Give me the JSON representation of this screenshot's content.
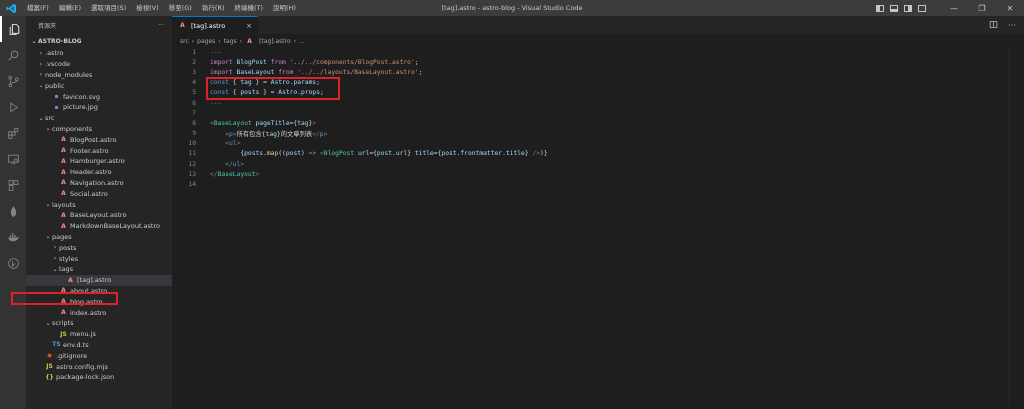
{
  "titlebar": {
    "menu": [
      "檔案(F)",
      "編輯(E)",
      "選取項目(S)",
      "檢視(V)",
      "移至(G)",
      "執行(R)",
      "終端機(T)",
      "說明(H)"
    ],
    "window_title": "[tag].astro - astro-blog - Visual Studio Code",
    "minimize": "—",
    "maximize": "❐",
    "close": "✕"
  },
  "sidebar": {
    "header": "資源夾",
    "more": "···",
    "project": "ASTRO-BLOG",
    "tree": [
      {
        "label": ".astro",
        "indent": 1,
        "chev": "›",
        "icon": ""
      },
      {
        "label": ".vscode",
        "indent": 1,
        "chev": "›",
        "icon": ""
      },
      {
        "label": "node_modules",
        "indent": 1,
        "chev": "›",
        "icon": ""
      },
      {
        "label": "public",
        "indent": 1,
        "chev": "⌄",
        "icon": ""
      },
      {
        "label": "favicon.svg",
        "indent": 2,
        "chev": "",
        "icon": "img"
      },
      {
        "label": "picture.jpg",
        "indent": 2,
        "chev": "",
        "icon": "img"
      },
      {
        "label": "src",
        "indent": 1,
        "chev": "⌄",
        "icon": ""
      },
      {
        "label": "components",
        "indent": 2,
        "chev": "⌄",
        "icon": ""
      },
      {
        "label": "BlogPost.astro",
        "indent": 3,
        "chev": "",
        "icon": "astro"
      },
      {
        "label": "Footer.astro",
        "indent": 3,
        "chev": "",
        "icon": "astro"
      },
      {
        "label": "Hamburger.astro",
        "indent": 3,
        "chev": "",
        "icon": "astro"
      },
      {
        "label": "Header.astro",
        "indent": 3,
        "chev": "",
        "icon": "astro"
      },
      {
        "label": "Navigation.astro",
        "indent": 3,
        "chev": "",
        "icon": "astro"
      },
      {
        "label": "Social.astro",
        "indent": 3,
        "chev": "",
        "icon": "astro"
      },
      {
        "label": "layouts",
        "indent": 2,
        "chev": "⌄",
        "icon": ""
      },
      {
        "label": "BaseLayout.astro",
        "indent": 3,
        "chev": "",
        "icon": "astro"
      },
      {
        "label": "MarkdownBaseLayout.astro",
        "indent": 3,
        "chev": "",
        "icon": "astro"
      },
      {
        "label": "pages",
        "indent": 2,
        "chev": "⌄",
        "icon": ""
      },
      {
        "label": "posts",
        "indent": 3,
        "chev": "›",
        "icon": ""
      },
      {
        "label": "styles",
        "indent": 3,
        "chev": "›",
        "icon": ""
      },
      {
        "label": "tags",
        "indent": 3,
        "chev": "⌄",
        "icon": ""
      },
      {
        "label": "[tag].astro",
        "indent": 4,
        "chev": "",
        "icon": "astro",
        "selected": true
      },
      {
        "label": "about.astro",
        "indent": 3,
        "chev": "",
        "icon": "astro"
      },
      {
        "label": "blog.astro",
        "indent": 3,
        "chev": "",
        "icon": "astro"
      },
      {
        "label": "index.astro",
        "indent": 3,
        "chev": "",
        "icon": "astro"
      },
      {
        "label": "scripts",
        "indent": 2,
        "chev": "⌄",
        "icon": ""
      },
      {
        "label": "menu.js",
        "indent": 3,
        "chev": "",
        "icon": "js"
      },
      {
        "label": "env.d.ts",
        "indent": 2,
        "chev": "",
        "icon": "ts"
      },
      {
        "label": ".gitignore",
        "indent": 1,
        "chev": "",
        "icon": "git"
      },
      {
        "label": "astro.config.mjs",
        "indent": 1,
        "chev": "",
        "icon": "js"
      },
      {
        "label": "package-lock.json",
        "indent": 1,
        "chev": "",
        "icon": "json"
      }
    ]
  },
  "editor": {
    "tab_label": "[tag].astro",
    "tab_close": "×",
    "breadcrumb": [
      "src",
      "pages",
      "tags",
      "[tag].astro",
      "..."
    ],
    "lines": [
      [
        [
          "c-gray",
          "---"
        ]
      ],
      [
        [
          "c-kw",
          "import "
        ],
        [
          "c-var",
          "BlogPost"
        ],
        [
          "c-kw",
          " from "
        ],
        [
          "c-str",
          "'../../components/BlogPost.astro'"
        ],
        [
          "c-text",
          ";"
        ]
      ],
      [
        [
          "c-kw",
          "import "
        ],
        [
          "c-var",
          "BaseLayout"
        ],
        [
          "c-kw",
          " from "
        ],
        [
          "c-str",
          "'../../layouts/BaseLayout.astro'"
        ],
        [
          "c-text",
          ";"
        ]
      ],
      [
        [
          "c-blue",
          "const "
        ],
        [
          "c-text",
          "{ "
        ],
        [
          "c-var",
          "tag"
        ],
        [
          "c-text",
          " } = "
        ],
        [
          "c-var",
          "Astro"
        ],
        [
          "c-text",
          "."
        ],
        [
          "c-var",
          "params"
        ],
        [
          "c-text",
          ";"
        ]
      ],
      [
        [
          "c-blue",
          "const "
        ],
        [
          "c-text",
          "{ "
        ],
        [
          "c-var",
          "posts"
        ],
        [
          "c-text",
          " } = "
        ],
        [
          "c-var",
          "Astro"
        ],
        [
          "c-text",
          "."
        ],
        [
          "c-var",
          "props"
        ],
        [
          "c-text",
          ";"
        ]
      ],
      [
        [
          "c-gray",
          "---"
        ]
      ],
      [],
      [
        [
          "c-gray",
          "<"
        ],
        [
          "c-type",
          "BaseLayout"
        ],
        [
          "c-var",
          " pageTitle"
        ],
        [
          "c-text",
          "={"
        ],
        [
          "c-var",
          "tag"
        ],
        [
          "c-text",
          "}"
        ],
        [
          "c-gray",
          ">"
        ]
      ],
      [
        [
          "c-text",
          "    "
        ],
        [
          "c-gray",
          "<"
        ],
        [
          "c-tag",
          "p"
        ],
        [
          "c-gray",
          ">"
        ],
        [
          "c-text",
          "所有包含{"
        ],
        [
          "c-var",
          "tag"
        ],
        [
          "c-text",
          "}的文章列表"
        ],
        [
          "c-gray",
          "</"
        ],
        [
          "c-tag",
          "p"
        ],
        [
          "c-gray",
          ">"
        ]
      ],
      [
        [
          "c-text",
          "    "
        ],
        [
          "c-gray",
          "<"
        ],
        [
          "c-tag",
          "ul"
        ],
        [
          "c-gray",
          ">"
        ]
      ],
      [
        [
          "c-text",
          "        {"
        ],
        [
          "c-var",
          "posts"
        ],
        [
          "c-text",
          "."
        ],
        [
          "c-fn",
          "map"
        ],
        [
          "c-text",
          "(("
        ],
        [
          "c-var",
          "post"
        ],
        [
          "c-text",
          ") "
        ],
        [
          "c-blue",
          "=>"
        ],
        [
          "c-text",
          " "
        ],
        [
          "c-gray",
          "<"
        ],
        [
          "c-type",
          "BlogPost"
        ],
        [
          "c-var",
          " url"
        ],
        [
          "c-text",
          "={"
        ],
        [
          "c-var",
          "post"
        ],
        [
          "c-text",
          "."
        ],
        [
          "c-var",
          "url"
        ],
        [
          "c-text",
          "} "
        ],
        [
          "c-var",
          "title"
        ],
        [
          "c-text",
          "={"
        ],
        [
          "c-var",
          "post"
        ],
        [
          "c-text",
          "."
        ],
        [
          "c-var",
          "frontmatter"
        ],
        [
          "c-text",
          "."
        ],
        [
          "c-var",
          "title"
        ],
        [
          "c-text",
          "} "
        ],
        [
          "c-gray",
          "/>"
        ],
        [
          "c-text",
          ")}"
        ]
      ],
      [
        [
          "c-text",
          "    "
        ],
        [
          "c-gray",
          "</"
        ],
        [
          "c-tag",
          "ul"
        ],
        [
          "c-gray",
          ">"
        ]
      ],
      [
        [
          "c-gray",
          "</"
        ],
        [
          "c-type",
          "BaseLayout"
        ],
        [
          "c-gray",
          ">"
        ]
      ],
      []
    ]
  },
  "colors": {
    "accent": "#0078d4",
    "highlight": "#e0202a"
  }
}
